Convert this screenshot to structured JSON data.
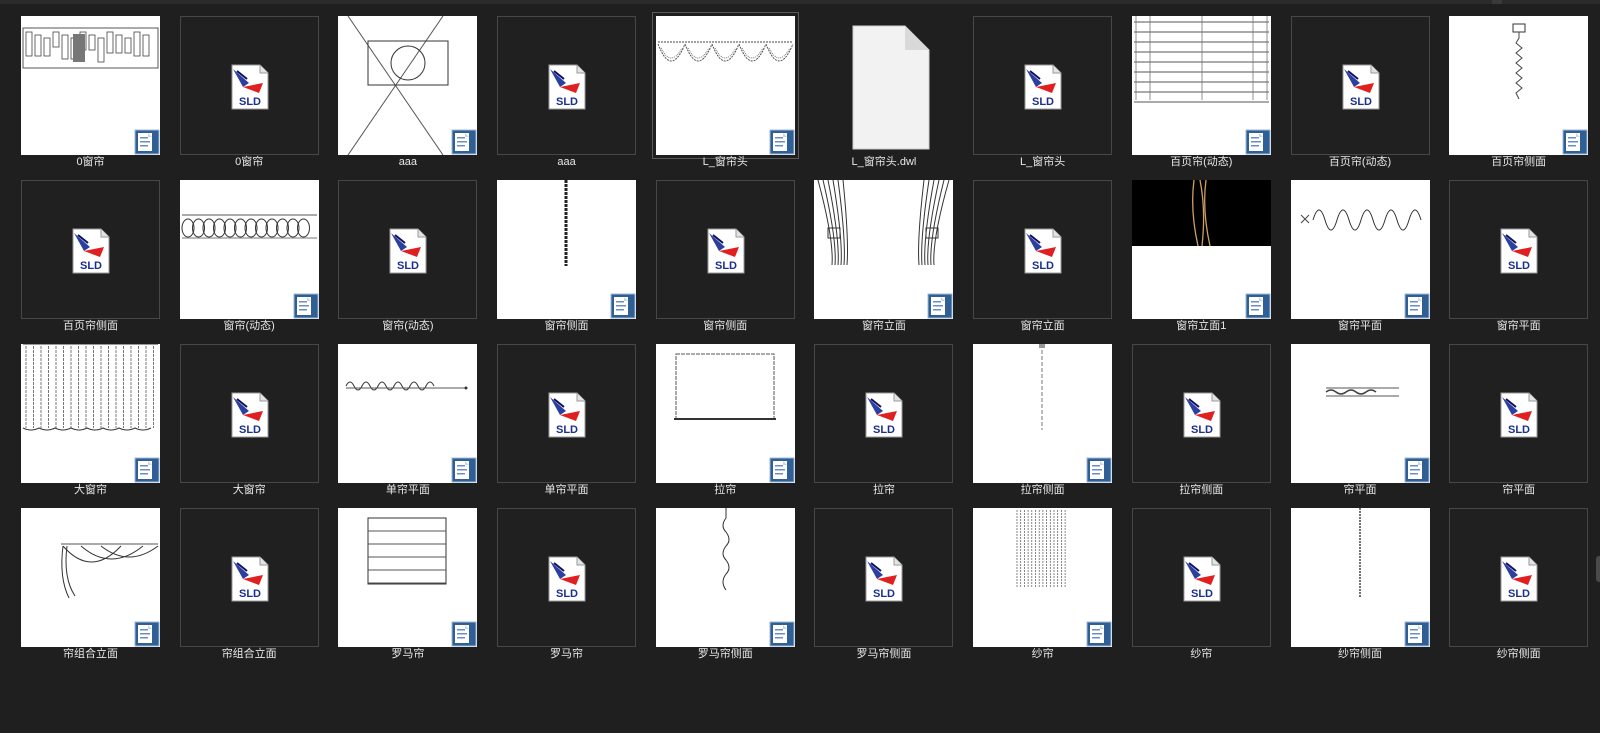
{
  "items": [
    {
      "label": "0窗帘",
      "kind": "preview",
      "art": "strip"
    },
    {
      "label": "0窗帘",
      "kind": "sld"
    },
    {
      "label": "aaa",
      "kind": "preview",
      "art": "cross"
    },
    {
      "label": "aaa",
      "kind": "sld"
    },
    {
      "label": "L_窗帘头",
      "kind": "preview",
      "art": "valance"
    },
    {
      "label": "L_窗帘头.dwl",
      "kind": "blank"
    },
    {
      "label": "L_窗帘头",
      "kind": "sld"
    },
    {
      "label": "百页帘(动态)",
      "kind": "preview",
      "art": "blinds"
    },
    {
      "label": "百页帘(动态)",
      "kind": "sld"
    },
    {
      "label": "百页帘侧面",
      "kind": "preview",
      "art": "chain"
    },
    {
      "label": "百页帘侧面",
      "kind": "sld"
    },
    {
      "label": "窗帘(动态)",
      "kind": "preview",
      "art": "loops"
    },
    {
      "label": "窗帘(动态)",
      "kind": "sld"
    },
    {
      "label": "窗帘侧面",
      "kind": "preview",
      "art": "vline"
    },
    {
      "label": "窗帘侧面",
      "kind": "sld"
    },
    {
      "label": "窗帘立面",
      "kind": "preview",
      "art": "drapes"
    },
    {
      "label": "窗帘立面",
      "kind": "sld"
    },
    {
      "label": "窗帘立面1",
      "kind": "preview",
      "art": "blackdrape"
    },
    {
      "label": "窗帘平面",
      "kind": "preview",
      "art": "wave"
    },
    {
      "label": "窗帘平面",
      "kind": "sld"
    },
    {
      "label": "大窗帘",
      "kind": "preview",
      "art": "curtain"
    },
    {
      "label": "大窗帘",
      "kind": "sld"
    },
    {
      "label": "单帘平面",
      "kind": "preview",
      "art": "hwave"
    },
    {
      "label": "单帘平面",
      "kind": "sld"
    },
    {
      "label": "拉帘",
      "kind": "preview",
      "art": "frame"
    },
    {
      "label": "拉帘",
      "kind": "sld"
    },
    {
      "label": "拉帘侧面",
      "kind": "preview",
      "art": "thinline"
    },
    {
      "label": "拉帘侧面",
      "kind": "sld"
    },
    {
      "label": "帘平面",
      "kind": "preview",
      "art": "smallwave"
    },
    {
      "label": "帘平面",
      "kind": "sld"
    },
    {
      "label": "帘组合立面",
      "kind": "preview",
      "art": "swag"
    },
    {
      "label": "帘组合立面",
      "kind": "sld"
    },
    {
      "label": "罗马帘",
      "kind": "preview",
      "art": "roman"
    },
    {
      "label": "罗马帘",
      "kind": "sld"
    },
    {
      "label": "罗马帘侧面",
      "kind": "preview",
      "art": "zigzag"
    },
    {
      "label": "罗马帘侧面",
      "kind": "sld"
    },
    {
      "label": "纱帘",
      "kind": "preview",
      "art": "sheer"
    },
    {
      "label": "纱帘",
      "kind": "sld"
    },
    {
      "label": "纱帘侧面",
      "kind": "preview",
      "art": "dotline"
    },
    {
      "label": "纱帘侧面",
      "kind": "sld"
    }
  ],
  "selected_index": 4,
  "sld_text": "SLD",
  "colors": {
    "background": "#1f1f1f",
    "label": "#e8e8e8",
    "tile_border": "#474747",
    "badge": "#2f5f95"
  }
}
